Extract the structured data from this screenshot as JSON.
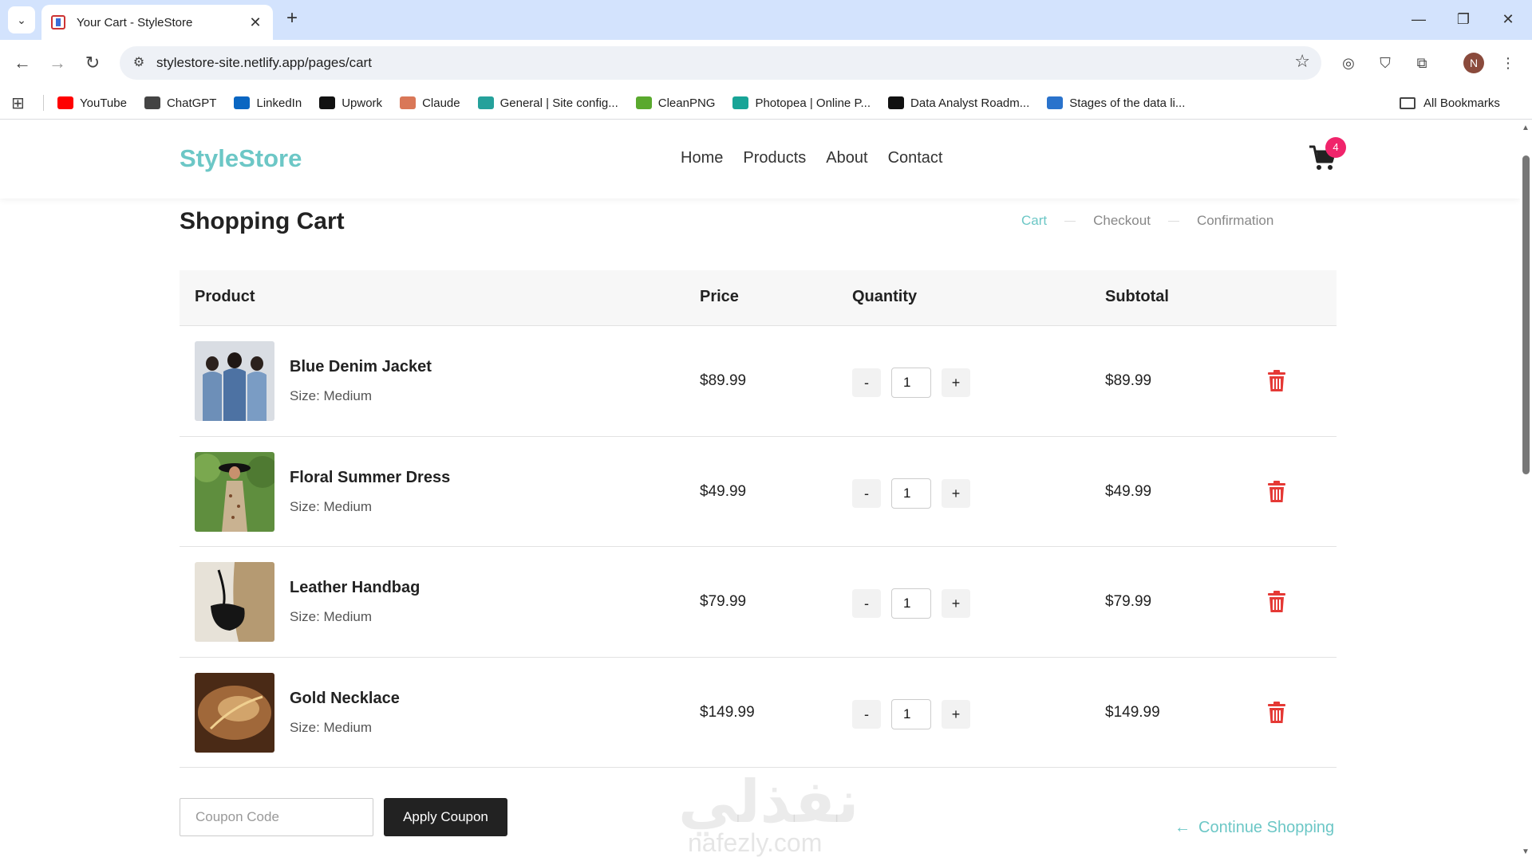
{
  "browser": {
    "tab_title": "Your Cart - StyleStore",
    "url": "stylestore-site.netlify.app/pages/cart",
    "profile_initial": "N",
    "bookmarks": [
      {
        "label": "YouTube",
        "icon": "youtube-icon",
        "color": "#ff0000"
      },
      {
        "label": "ChatGPT",
        "icon": "chatgpt-icon",
        "color": "#444444"
      },
      {
        "label": "LinkedIn",
        "icon": "linkedin-icon",
        "color": "#0a66c2"
      },
      {
        "label": "Upwork",
        "icon": "upwork-icon",
        "color": "#111111"
      },
      {
        "label": "Claude",
        "icon": "claude-icon",
        "color": "#d97757"
      },
      {
        "label": "General | Site config...",
        "icon": "netlify-icon",
        "color": "#25a19b"
      },
      {
        "label": "CleanPNG",
        "icon": "cleanpng-icon",
        "color": "#5aa92e"
      },
      {
        "label": "Photopea | Online P...",
        "icon": "photopea-icon",
        "color": "#18a497"
      },
      {
        "label": "Data Analyst Roadm...",
        "icon": "roadmap-icon",
        "color": "#111111"
      },
      {
        "label": "Stages of the data li...",
        "icon": "coursera-icon",
        "color": "#2a73cc"
      }
    ],
    "all_bookmarks": "All Bookmarks"
  },
  "site": {
    "logo": "StyleStore",
    "nav": [
      "Home",
      "Products",
      "About",
      "Contact"
    ],
    "cart_count": "4"
  },
  "cart": {
    "title": "Shopping Cart",
    "steps": [
      "Cart",
      "Checkout",
      "Confirmation"
    ],
    "active_step": "Cart",
    "headers": {
      "product": "Product",
      "price": "Price",
      "quantity": "Quantity",
      "subtotal": "Subtotal"
    },
    "items": [
      {
        "name": "Blue Denim Jacket",
        "size": "Size: Medium",
        "price": "$89.99",
        "qty": "1",
        "subtotal": "$89.99",
        "minus": "-",
        "plus": "+"
      },
      {
        "name": "Floral Summer Dress",
        "size": "Size: Medium",
        "price": "$49.99",
        "qty": "1",
        "subtotal": "$49.99",
        "minus": "-",
        "plus": "+"
      },
      {
        "name": "Leather Handbag",
        "size": "Size: Medium",
        "price": "$79.99",
        "qty": "1",
        "subtotal": "$79.99",
        "minus": "-",
        "plus": "+"
      },
      {
        "name": "Gold Necklace",
        "size": "Size: Medium",
        "price": "$149.99",
        "qty": "1",
        "subtotal": "$149.99",
        "minus": "-",
        "plus": "+"
      }
    ],
    "coupon_placeholder": "Coupon Code",
    "apply_coupon": "Apply Coupon",
    "continue_shopping": "Continue Shopping"
  },
  "watermark": {
    "arabic": "نفذلي",
    "latin": "nafezly.com"
  },
  "colors": {
    "accent": "#6cc7c6",
    "badge": "#f0246b",
    "danger": "#e53935",
    "dark_button": "#222222"
  }
}
